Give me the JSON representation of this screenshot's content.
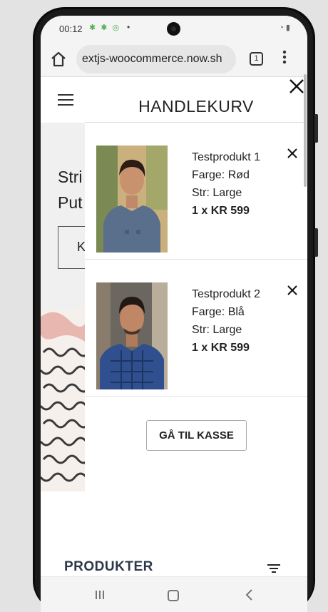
{
  "status": {
    "time": "00:12",
    "icons": [
      "android-icon",
      "android-icon",
      "location-icon"
    ],
    "dot": "•",
    "right": "wifi signal battery"
  },
  "browser": {
    "url": "extjs-woocommerce.now.sh",
    "tab_count": "1",
    "menu": "⋮"
  },
  "page": {
    "hero_line1": "Stri",
    "hero_line2": "Put",
    "hero_button": "K",
    "products_title": "PRODUKTER"
  },
  "cart": {
    "title": "HANDLEKURV",
    "items": [
      {
        "name": "Testprodukt 1",
        "color": "Farge: Rød",
        "size": "Str: Large",
        "qty_price": "1 x KR 599"
      },
      {
        "name": "Testprodukt 2",
        "color": "Farge: Blå",
        "size": "Str: Large",
        "qty_price": "1 x KR 599"
      }
    ],
    "checkout_label": "GÅ TIL KASSE"
  },
  "colors": {
    "products_title": "#2d3748",
    "item1_shirt": "#5a6f8c",
    "item2_shirt": "#2f4f8f"
  }
}
